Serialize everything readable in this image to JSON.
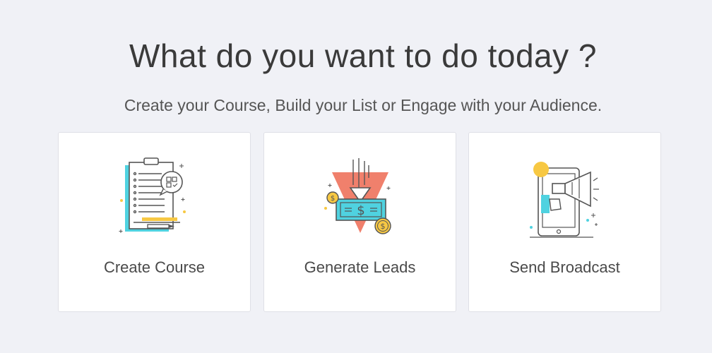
{
  "header": {
    "title": "What do you want to do today ?",
    "subtitle": "Create your Course, Build your List or Engage with your Audience."
  },
  "cards": [
    {
      "label": "Create Course",
      "icon": "clipboard-checklist-icon"
    },
    {
      "label": "Generate Leads",
      "icon": "money-leads-icon"
    },
    {
      "label": "Send Broadcast",
      "icon": "megaphone-phone-icon"
    }
  ],
  "colors": {
    "background": "#f0f1f6",
    "card_background": "#ffffff",
    "accent_teal": "#4fd2e0",
    "accent_yellow": "#f7c843",
    "accent_coral": "#f0806c",
    "line": "#555555"
  }
}
